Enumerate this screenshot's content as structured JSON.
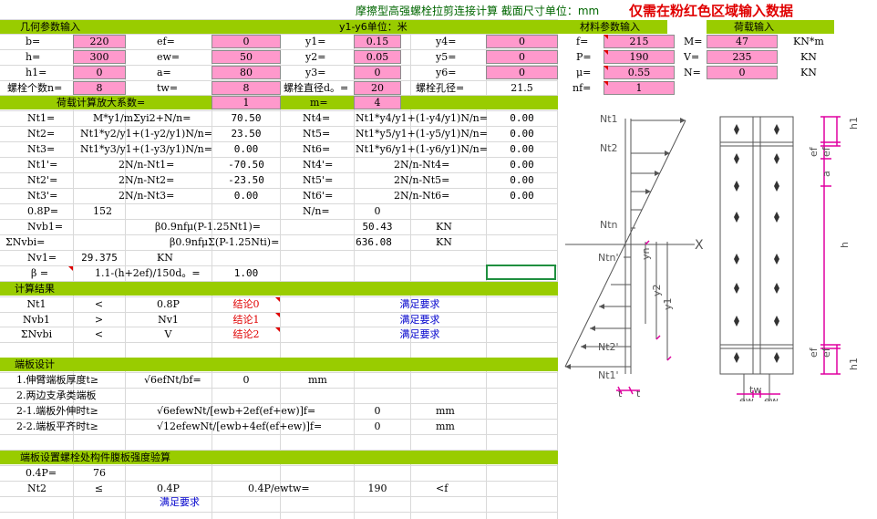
{
  "header": {
    "title": "摩擦型高强螺栓拉剪连接计算  截面尺寸单位：mm",
    "warning": "仅需在粉红色区域输入数据"
  },
  "geo": {
    "section": "几何参数输入",
    "y_unit": "y1-y6单位：米",
    "b_label": "b=",
    "b": "220",
    "h_label": "h=",
    "h": "300",
    "h1_label": "h1=",
    "h1": "0",
    "n_label": "螺栓个数n=",
    "n": "8",
    "ef_label": "ef=",
    "ef": "0",
    "ew_label": "ew=",
    "ew": "50",
    "a_label": "a=",
    "a": "80",
    "tw_label": "tw=",
    "tw": "8",
    "y1_label": "y1=",
    "y1": "0.15",
    "y2_label": "y2=",
    "y2": "0.05",
    "y3_label": "y3=",
    "y3": "0",
    "d0_label": "螺栓直径d。=",
    "d0": "20",
    "y4_label": "y4=",
    "y4": "0",
    "y5_label": "y5=",
    "y5": "0",
    "y6_label": "y6=",
    "y6": "0",
    "hole_label": "螺栓孔径=",
    "hole": "21.5"
  },
  "material": {
    "section": "材料参数输入",
    "f_label": "f=",
    "f": "215",
    "P_label": "P=",
    "P": "190",
    "mu_label": "μ=",
    "mu": "0.55",
    "nf_label": "nf=",
    "nf": "1"
  },
  "load": {
    "section": "荷载输入",
    "M_label": "M=",
    "M": "47",
    "M_unit": "KN*m",
    "V_label": "V=",
    "V": "235",
    "V_unit": "KN",
    "N_label": "N=",
    "N": "0",
    "N_unit": "KN"
  },
  "amplify": {
    "label": "荷载计算放大系数=",
    "value": "1",
    "m_label": "m=",
    "m": "4"
  },
  "calc": {
    "nt1_label": "Nt1=",
    "nt1_formula": "M*y1/mΣyi2+N/n=",
    "nt1": "70.50",
    "nt2_label": "Nt2=",
    "nt2_formula": "Nt1*y2/y1+(1-y2/y1)N/n=",
    "nt2": "23.50",
    "nt3_label": "Nt3=",
    "nt3_formula": "Nt1*y3/y1+(1-y3/y1)N/n=",
    "nt3": "0.00",
    "nt1p_label": "Nt1'=",
    "nt1p_formula": "2N/n-Nt1=",
    "nt1p": "-70.50",
    "nt2p_label": "Nt2'=",
    "nt2p_formula": "2N/n-Nt2=",
    "nt2p": "-23.50",
    "nt3p_label": "Nt3'=",
    "nt3p_formula": "2N/n-Nt3=",
    "nt3p": "0.00",
    "nt4_label": "Nt4=",
    "nt4_formula": "Nt1*y4/y1+(1-y4/y1)N/n=",
    "nt4": "0.00",
    "nt5_label": "Nt5=",
    "nt5_formula": "Nt1*y5/y1+(1-y5/y1)N/n=",
    "nt5": "0.00",
    "nt6_label": "Nt6=",
    "nt6_formula": "Nt1*y6/y1+(1-y6/y1)N/n=",
    "nt6": "0.00",
    "nt4p_label": "Nt4'=",
    "nt4p_formula": "2N/n-Nt4=",
    "nt4p": "0.00",
    "nt5p_label": "Nt5'=",
    "nt5p_formula": "2N/n-Nt5=",
    "nt5p": "0.00",
    "nt6p_label": "Nt6'=",
    "nt6p_formula": "2N/n-Nt6=",
    "nt6p": "0.00",
    "p08_label": "0.8P=",
    "p08": "152",
    "nn_label": "N/n=",
    "nn": "0",
    "nvb1_label": "Nvb1=",
    "nvb1_formula": "β0.9nfμ(P-1.25Nt1)=",
    "nvb1": "50.43",
    "nvb1_unit": "KN",
    "snvbi_label": "ΣNvbi=",
    "snvbi_formula": "β0.9nfμΣ(P-1.25Nti)=",
    "snvbi": "636.08",
    "snvbi_unit": "KN",
    "nv1_label": "Nv1=",
    "nv1": "29.375",
    "nv1_unit": "KN",
    "beta_label": "β =",
    "beta_formula": "1.1-(h+2ef)/150d。=",
    "beta": "1.00"
  },
  "result": {
    "section": "计算结果",
    "rows": [
      {
        "a": "Nt1",
        "op": "<",
        "b": "0.8P",
        "concl": "结论0",
        "ok": "满足要求"
      },
      {
        "a": "Nvb1",
        "op": ">",
        "b": "Nv1",
        "concl": "结论1",
        "ok": "满足要求"
      },
      {
        "a": "ΣNvbi",
        "op": "<",
        "b": "V",
        "concl": "结论2",
        "ok": "满足要求"
      }
    ]
  },
  "plate": {
    "section": "端板设计",
    "r1_label": "1.伸臂端板厚度t≥",
    "r1_formula": "√6efNt/bf=",
    "r1": "0",
    "r1_unit": "mm",
    "r2_label": "2.两边支承类端板",
    "r3_label": "2-1.端板外伸时t≥",
    "r3_formula": "√6efewNt/[ewb+2ef(ef+ew)]f=",
    "r3": "0",
    "r3_unit": "mm",
    "r4_label": "2-2.端板平齐时t≥",
    "r4_formula": "√12efewNt/[ewb+4ef(ef+ew)]f=",
    "r4": "0",
    "r4_unit": "mm"
  },
  "web": {
    "section": "端板设置螺栓处构件腹板强度验算",
    "p04_label": "0.4P=",
    "p04": "76",
    "nt2_label": "Nt2",
    "op": "≤",
    "p04b": "0.4P",
    "formula": "0.4P/ewtw=",
    "value": "190",
    "cmp": "<f",
    "ok": "满足要求"
  },
  "diagram": {
    "labels": [
      "Nt1",
      "Nt2",
      "Ntn",
      "Ntn'",
      "Nt2'",
      "Nt1'",
      "X",
      "yn",
      "y2",
      "y1",
      "t",
      "t",
      "h1",
      "ef",
      "ef",
      "a",
      "h",
      "ef",
      "ef",
      "h1",
      "ew",
      "tw",
      "ew"
    ]
  }
}
